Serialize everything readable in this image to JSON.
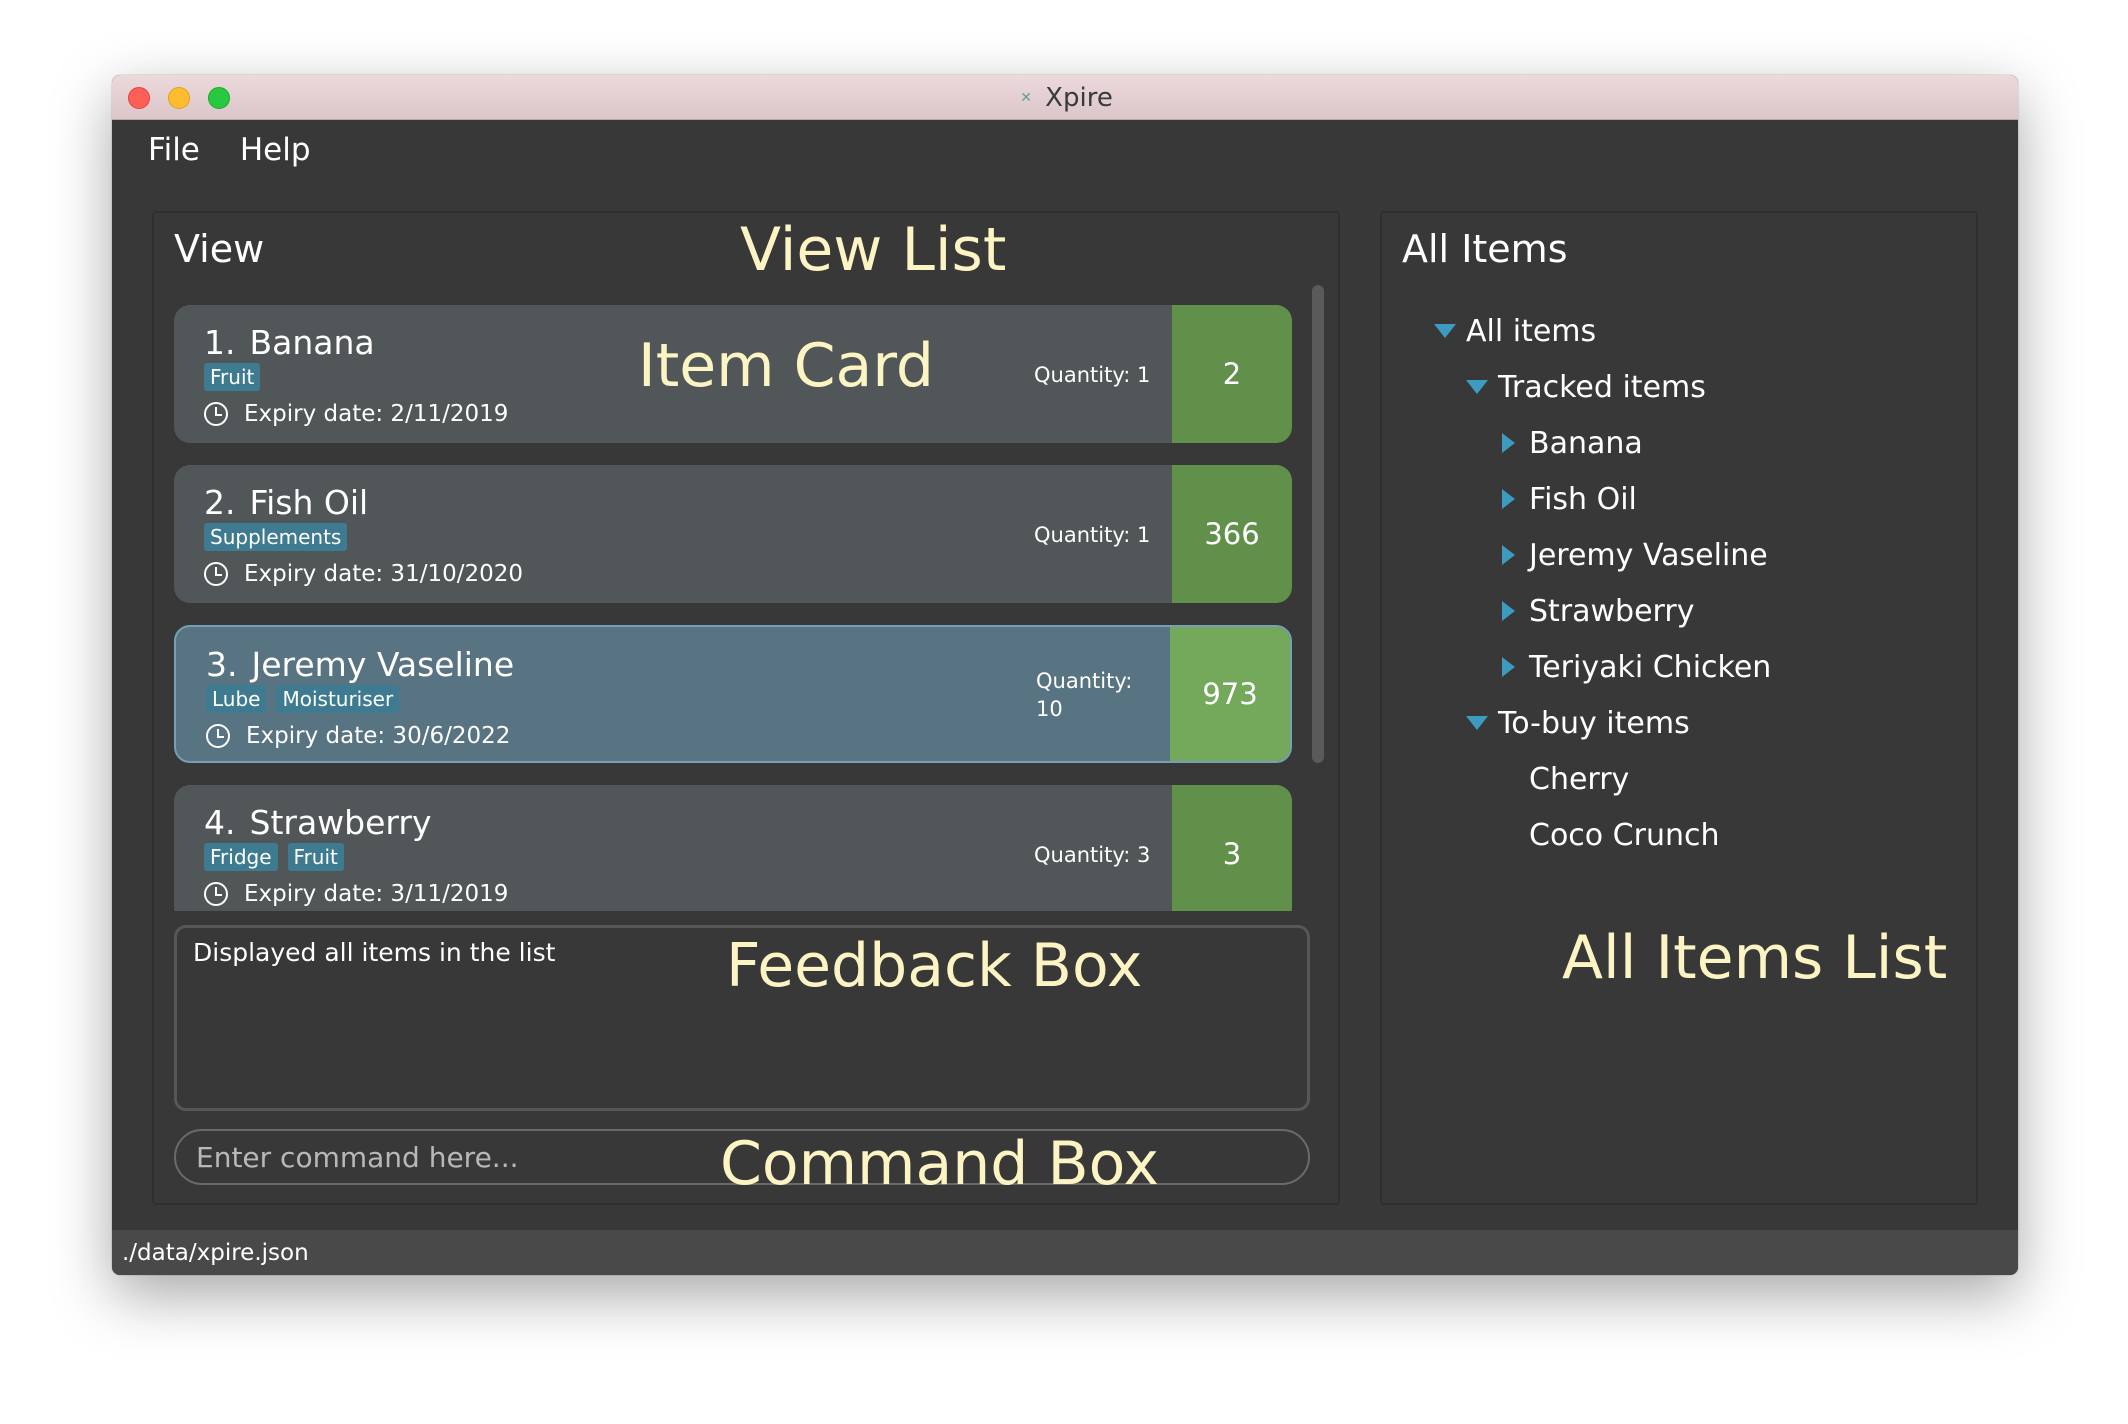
{
  "window": {
    "title": "Xpire",
    "app_icon": "xpire-logo-icon"
  },
  "menubar": {
    "items": [
      {
        "label": "File"
      },
      {
        "label": "Help"
      }
    ]
  },
  "view_panel": {
    "title": "View",
    "annotation": "View List",
    "card_annotation": "Item Card",
    "items": [
      {
        "index": "1.",
        "name": "Banana",
        "tags": [
          "Fruit"
        ],
        "expiry": "Expiry date: 2/11/2019",
        "quantity": "Quantity: 1",
        "days_left": "2",
        "selected": false
      },
      {
        "index": "2.",
        "name": "Fish Oil",
        "tags": [
          "Supplements"
        ],
        "expiry": "Expiry date: 31/10/2020",
        "quantity": "Quantity: 1",
        "days_left": "366",
        "selected": false
      },
      {
        "index": "3.",
        "name": "Jeremy Vaseline",
        "tags": [
          "Lube",
          "Moisturiser"
        ],
        "expiry": "Expiry date: 30/6/2022",
        "quantity": "Quantity: 10",
        "quantity_label": "Quantity:",
        "quantity_value": "10",
        "days_left": "973",
        "selected": true
      },
      {
        "index": "4.",
        "name": "Strawberry",
        "tags": [
          "Fridge",
          "Fruit"
        ],
        "expiry": "Expiry date: 3/11/2019",
        "quantity": "Quantity: 3",
        "days_left": "3",
        "selected": false
      }
    ]
  },
  "feedback": {
    "text": "Displayed all items in the list",
    "annotation": "Feedback Box"
  },
  "command": {
    "placeholder": "Enter command here...",
    "value": "",
    "annotation": "Command Box"
  },
  "all_items_panel": {
    "title": "All Items",
    "annotation": "All Items List",
    "tree": {
      "root": "All items",
      "tracked": {
        "label": "Tracked items",
        "items": [
          "Banana",
          "Fish Oil",
          "Jeremy Vaseline",
          "Strawberry",
          "Teriyaki Chicken"
        ]
      },
      "to_buy": {
        "label": "To-buy items",
        "items": [
          "Cherry",
          "Coco Crunch"
        ]
      }
    }
  },
  "statusbar": {
    "path": "./data/xpire.json"
  },
  "colors": {
    "window_bg": "#383838",
    "card_bg": "#515658",
    "card_selected_bg": "#587381",
    "days_bg": "#60904a",
    "days_selected_bg": "#74a85a",
    "tag_bg": "#3e7b91",
    "tree_arrow": "#3d9bc2",
    "annotation_text": "#fdf4c4"
  }
}
